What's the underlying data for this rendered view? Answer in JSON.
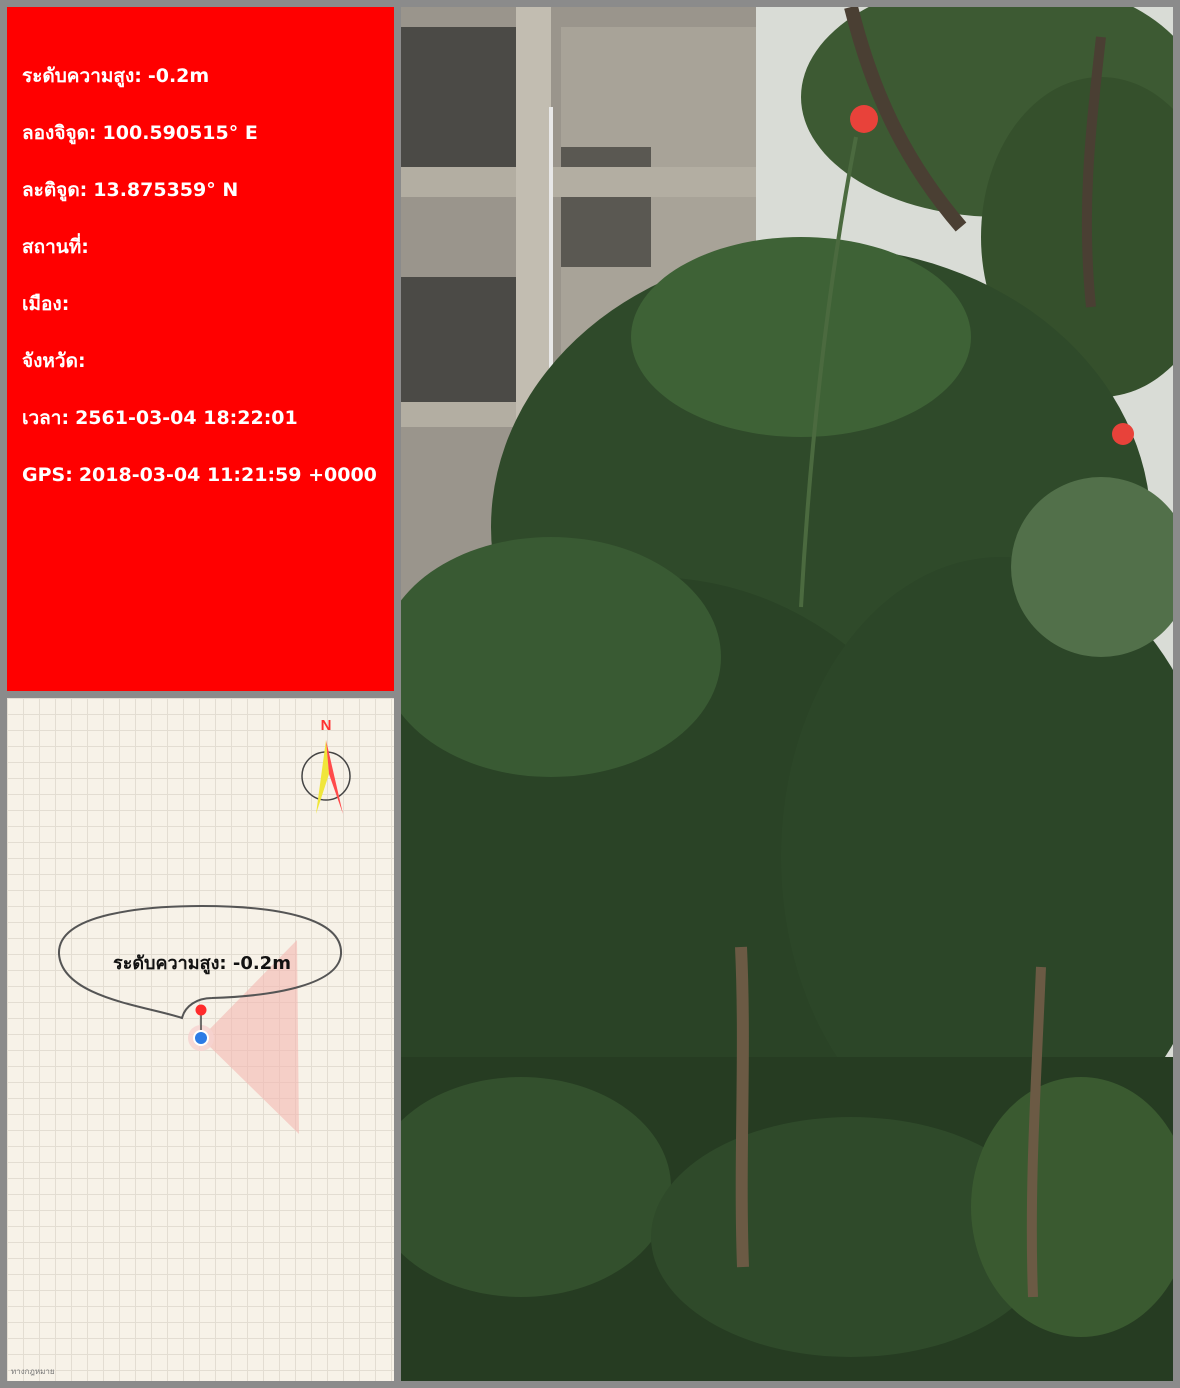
{
  "info_panel": {
    "background": "#ff0000",
    "rows": [
      {
        "label": "ระดับความสูง:",
        "value": "-0.2m"
      },
      {
        "label": "ลองจิจูด:",
        "value": "100.590515° E"
      },
      {
        "label": "ละติจูด:",
        "value": "13.875359° N"
      },
      {
        "label": "สถานที่:",
        "value": ""
      },
      {
        "label": "เมือง:",
        "value": ""
      },
      {
        "label": "จังหวัด:",
        "value": ""
      },
      {
        "label": "เวลา:",
        "value": "2561-03-04 18:22:01"
      },
      {
        "label": "GPS:",
        "value": "2018-03-04 11:21:59 +0000"
      }
    ]
  },
  "map": {
    "compass_label": "N",
    "bubble_text": "ระดับความสูง: -0.2m",
    "credit": "ทางกฎหมาย",
    "icons": [
      "compass-icon",
      "location-pin-icon",
      "current-location-icon"
    ]
  },
  "photo": {
    "subject": "plant-photo"
  }
}
